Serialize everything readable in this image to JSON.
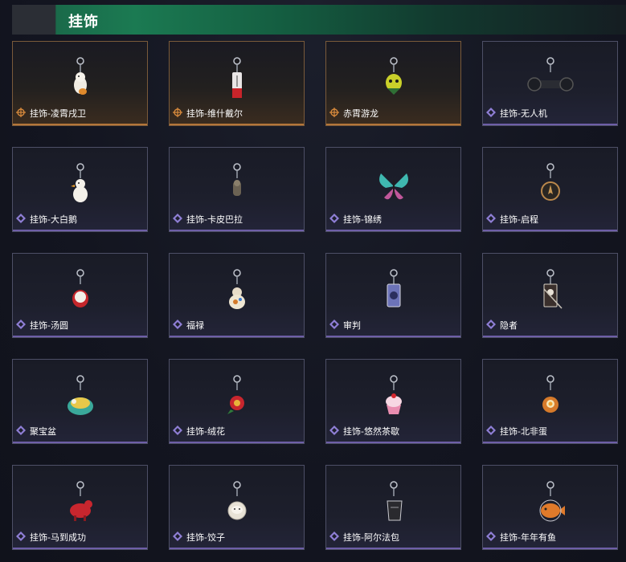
{
  "header": {
    "title": "挂饰"
  },
  "colors": {
    "orange": "#d88a3c",
    "purple": "#8f7fd6"
  },
  "items": [
    {
      "name": "挂饰-凌霄戌卫",
      "rarity": "orange",
      "icon": "dog-charm"
    },
    {
      "name": "挂饰-维什戴尔",
      "rarity": "orange",
      "icon": "tag-charm"
    },
    {
      "name": "赤霄游龙",
      "rarity": "orange",
      "icon": "dragon-head-charm"
    },
    {
      "name": "挂饰-无人机",
      "rarity": "purple",
      "icon": "drone-charm"
    },
    {
      "name": "挂饰-大白鹅",
      "rarity": "purple",
      "icon": "goose-charm"
    },
    {
      "name": "挂饰-卡皮巴拉",
      "rarity": "purple",
      "icon": "capybara-charm"
    },
    {
      "name": "挂饰-锦绣",
      "rarity": "purple",
      "icon": "butterfly-charm"
    },
    {
      "name": "挂饰-启程",
      "rarity": "purple",
      "icon": "compass-charm"
    },
    {
      "name": "挂饰-汤圆",
      "rarity": "purple",
      "icon": "dumpling-bowl-charm"
    },
    {
      "name": "福禄",
      "rarity": "purple",
      "icon": "gourd-charm"
    },
    {
      "name": "审判",
      "rarity": "purple",
      "icon": "card-charm"
    },
    {
      "name": "隐者",
      "rarity": "purple",
      "icon": "tarot-charm"
    },
    {
      "name": "聚宝盆",
      "rarity": "purple",
      "icon": "treasure-bowl-charm"
    },
    {
      "name": "挂饰-绒花",
      "rarity": "purple",
      "icon": "flower-charm"
    },
    {
      "name": "挂饰-悠然茶歇",
      "rarity": "purple",
      "icon": "cupcake-charm"
    },
    {
      "name": "挂饰-北非蛋",
      "rarity": "purple",
      "icon": "egg-dish-charm"
    },
    {
      "name": "挂饰-马到成功",
      "rarity": "purple",
      "icon": "horse-charm"
    },
    {
      "name": "挂饰-饺子",
      "rarity": "purple",
      "icon": "dumpling-plate-charm"
    },
    {
      "name": "挂饰-阿尔法包",
      "rarity": "purple",
      "icon": "bag-charm"
    },
    {
      "name": "挂饰-年年有鱼",
      "rarity": "purple",
      "icon": "fish-charm"
    }
  ]
}
